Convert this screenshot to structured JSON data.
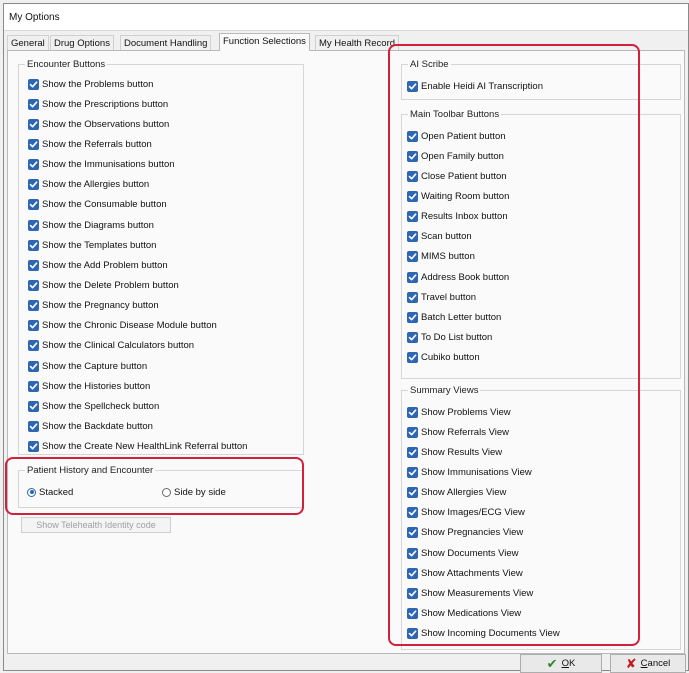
{
  "window": {
    "title": "My Options"
  },
  "tabs": [
    {
      "label": "General"
    },
    {
      "label": "Drug Options"
    },
    {
      "label": "Document Handling"
    },
    {
      "label": "Function Selections"
    },
    {
      "label": "My Health Record"
    }
  ],
  "active_tab": "Function Selections",
  "encounter": {
    "title": "Encounter Buttons",
    "items": [
      {
        "label": "Show the Problems button",
        "checked": true
      },
      {
        "label": "Show the Prescriptions button",
        "checked": true
      },
      {
        "label": "Show the Observations button",
        "checked": true
      },
      {
        "label": "Show the Referrals button",
        "checked": true
      },
      {
        "label": "Show the Immunisations button",
        "checked": true
      },
      {
        "label": "Show the Allergies button",
        "checked": true
      },
      {
        "label": "Show the Consumable button",
        "checked": true
      },
      {
        "label": "Show the Diagrams button",
        "checked": true
      },
      {
        "label": "Show the Templates button",
        "checked": true
      },
      {
        "label": "Show the Add Problem button",
        "checked": true
      },
      {
        "label": "Show the Delete Problem button",
        "checked": true
      },
      {
        "label": "Show the Pregnancy button",
        "checked": true
      },
      {
        "label": "Show the Chronic Disease Module button",
        "checked": true
      },
      {
        "label": "Show the Clinical Calculators button",
        "checked": true
      },
      {
        "label": "Show the Capture button",
        "checked": true
      },
      {
        "label": "Show the Histories button",
        "checked": true
      },
      {
        "label": "Show the Spellcheck button",
        "checked": true
      },
      {
        "label": "Show the Backdate button",
        "checked": true
      },
      {
        "label": "Show the Create New HealthLink Referral button",
        "checked": true
      }
    ]
  },
  "history": {
    "title": "Patient History and Encounter",
    "options": [
      {
        "label": "Stacked",
        "selected": true
      },
      {
        "label": "Side by side",
        "selected": false
      }
    ]
  },
  "telehealth_button": "Show Telehealth Identity code",
  "ai_scribe": {
    "title": "AI Scribe",
    "items": [
      {
        "label": "Enable Heidi AI Transcription",
        "checked": true
      }
    ]
  },
  "toolbar": {
    "title": "Main Toolbar Buttons",
    "items": [
      {
        "label": "Open Patient button",
        "checked": true
      },
      {
        "label": "Open Family button",
        "checked": true
      },
      {
        "label": "Close Patient button",
        "checked": true
      },
      {
        "label": "Waiting Room button",
        "checked": true
      },
      {
        "label": "Results Inbox button",
        "checked": true
      },
      {
        "label": "Scan button",
        "checked": true
      },
      {
        "label": "MIMS button",
        "checked": true
      },
      {
        "label": "Address Book button",
        "checked": true
      },
      {
        "label": "Travel button",
        "checked": true
      },
      {
        "label": "Batch Letter button",
        "checked": true
      },
      {
        "label": "To Do List button",
        "checked": true
      },
      {
        "label": "Cubiko button",
        "checked": true
      }
    ]
  },
  "summary": {
    "title": "Summary Views",
    "items": [
      {
        "label": "Show Problems View",
        "checked": true
      },
      {
        "label": "Show Referrals View",
        "checked": true
      },
      {
        "label": "Show Results View",
        "checked": true
      },
      {
        "label": "Show Immunisations View",
        "checked": true
      },
      {
        "label": "Show Allergies View",
        "checked": true
      },
      {
        "label": "Show Images/ECG View",
        "checked": true
      },
      {
        "label": "Show Pregnancies View",
        "checked": true
      },
      {
        "label": "Show Documents View",
        "checked": true
      },
      {
        "label": "Show Attachments View",
        "checked": true
      },
      {
        "label": "Show Measurements View",
        "checked": true
      },
      {
        "label": "Show Medications View",
        "checked": true
      },
      {
        "label": "Show Incoming Documents View",
        "checked": true
      }
    ]
  },
  "footer": {
    "ok_u": "O",
    "ok_rest": "K",
    "cancel_u": "C",
    "cancel_rest": "ancel"
  },
  "colors": {
    "checkbox": "#2d67b4",
    "highlight": "#d0213d",
    "ok_icon": "#2a8a2a",
    "cancel_icon": "#c01a1a"
  },
  "icons": {
    "ok": "checkmark-icon",
    "cancel": "x-icon",
    "checkbox": "checkmark-icon"
  }
}
